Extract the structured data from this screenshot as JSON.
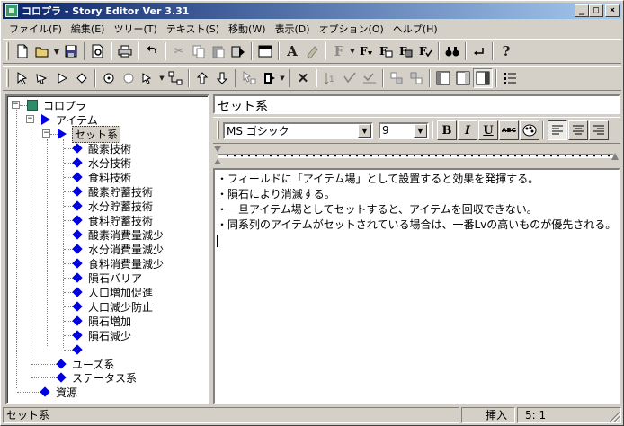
{
  "window": {
    "title": "コロプラ - Story Editor Ver 3.31",
    "controls": {
      "minimize": "_",
      "maximize": "□",
      "close": "×"
    }
  },
  "menu": [
    "ファイル(F)",
    "編集(E)",
    "ツリー(T)",
    "テキスト(S)",
    "移動(W)",
    "表示(D)",
    "オプション(O)",
    "ヘルプ(H)"
  ],
  "toolbar1": {
    "icons": [
      "new-file-icon",
      "open-folder-icon",
      "dropdown-arrow-icon",
      "save-icon",
      "print-preview-icon",
      "print-icon",
      "undo-icon",
      "cut-icon",
      "copy-icon",
      "paste-icon",
      "paste-special-icon",
      "window-icon",
      "font-a-icon",
      "highlighter-icon",
      "format-f-icon",
      "format-f-down-icon",
      "format-f-right-icon",
      "format-f-box-icon",
      "format-f-check-icon",
      "find-binoculars-icon",
      "replace-icon",
      "help-icon"
    ]
  },
  "toolbar2": {
    "icons": [
      "select-arrow-icon",
      "select-arrow2-icon",
      "play-icon",
      "diamond-icon",
      "circle-face-icon",
      "circle-icon",
      "dropdown-select-icon",
      "tree-link-icon",
      "move-up-icon",
      "move-down-icon",
      "cursor-node-icon",
      "insert-node-icon",
      "delete-x-icon",
      "sort-icon",
      "sort-check-icon",
      "sort-line-icon",
      "split-icon",
      "merge-icon",
      "layout-left-icon",
      "layout-center-icon",
      "layout-right-icon",
      "list-icon"
    ],
    "glyphs": {
      "font_a": "A",
      "format_f": "F",
      "delete": "✕",
      "help": "?"
    }
  },
  "tree": {
    "root": "コロプラ",
    "items": "アイテム",
    "selected": "セット系",
    "children": [
      "酸素技術",
      "水分技術",
      "食料技術",
      "酸素貯蓄技術",
      "水分貯蓄技術",
      "食料貯蓄技術",
      "酸素消費量減少",
      "水分消費量減少",
      "食料消費量減少",
      "隕石バリア",
      "人口増加促進",
      "人口減少防止",
      "隕石増加",
      "隕石減少",
      ""
    ],
    "siblings": [
      "ユーズ系",
      "ステータス系"
    ],
    "resources": "資源"
  },
  "editor": {
    "node_name": "セット系",
    "font": "MS ゴシック",
    "size": "9",
    "format_buttons": {
      "bold": "B",
      "italic": "I",
      "underline": "U",
      "strike": "ABC"
    },
    "lines": [
      "・フィールドに「アイテム場」として設置すると効果を発揮する。",
      "・隕石により消滅する。",
      "・一旦アイテム場としてセットすると、アイテムを回収できない。",
      "・同系列のアイテムがセットされている場合は、一番Lvの高いものが優先される。"
    ]
  },
  "status": {
    "selection": "セット系",
    "mode": "挿入",
    "position": "5:  1"
  },
  "colors": {
    "titlebar_start": "#0a246a",
    "titlebar_end": "#a6caf0",
    "tree_icon": "#0000e0",
    "root_icon": "#2f8c6a"
  }
}
